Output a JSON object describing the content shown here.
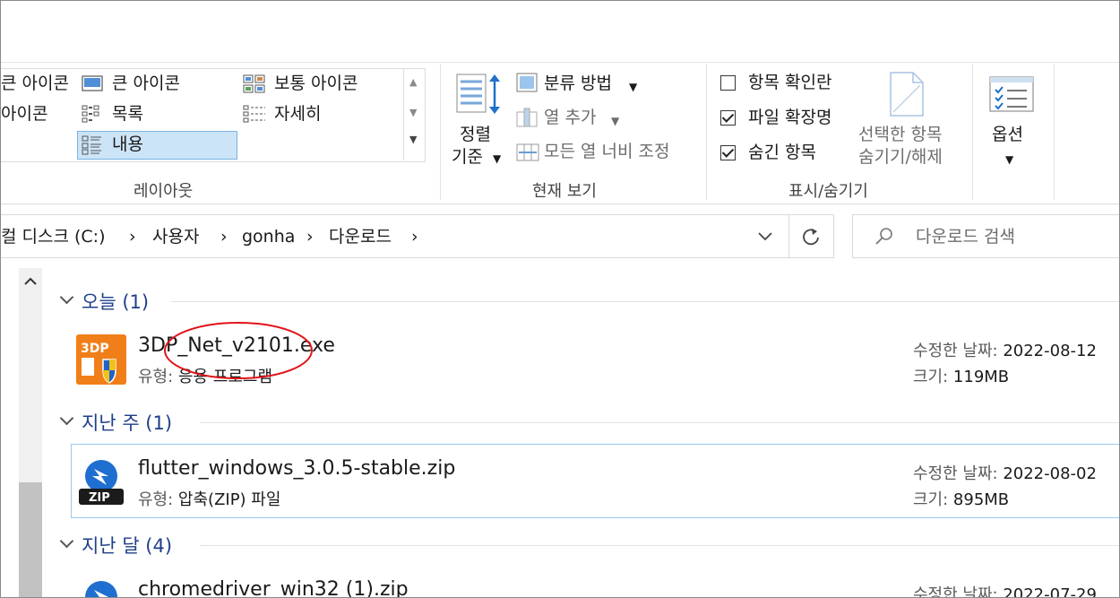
{
  "ribbon": {
    "layout": {
      "items": [
        "큰 아이콘",
        "큰 아이콘",
        "보통 아이콘",
        "아이콘",
        "목록",
        "자세히",
        "내용"
      ],
      "group_label": "레이아웃"
    },
    "current_view": {
      "sort_label_1": "정렬",
      "sort_label_2": "기준",
      "group_by": "분류 방법",
      "add_column": "열 추가",
      "fit_columns": "모든 열 너비 조정",
      "group_label": "현재 보기"
    },
    "show_hide": {
      "item_checkboxes": "항목 확인란",
      "file_extensions": "파일 확장명",
      "hidden_items": "숨긴 항목",
      "hide_selected_1": "선택한 항목",
      "hide_selected_2": "숨기기/해제",
      "group_label": "표시/숨기기"
    },
    "options": {
      "label": "옵션"
    }
  },
  "address": {
    "crumbs": [
      "컬 디스크 (C:)",
      "사용자",
      "gonha",
      "다운로드"
    ],
    "separator": "›"
  },
  "search": {
    "placeholder": "다운로드 검색"
  },
  "groups": [
    {
      "header": "오늘 (1)",
      "files": [
        {
          "name": "3DP_Net_v2101.exe",
          "type_label": "유형:",
          "type": "응용 프로그램",
          "modified_label": "수정한 날짜:",
          "modified": "2022-08-12",
          "size_label": "크기:",
          "size": "119MB",
          "icon": "3dp-app-icon"
        }
      ]
    },
    {
      "header": "지난 주 (1)",
      "files": [
        {
          "name": "flutter_windows_3.0.5-stable.zip",
          "type_label": "유형:",
          "type": "압축(ZIP) 파일",
          "modified_label": "수정한 날짜:",
          "modified": "2022-08-02",
          "size_label": "크기:",
          "size": "895MB",
          "icon": "zip-icon"
        }
      ]
    },
    {
      "header": "지난 달 (4)",
      "files": [
        {
          "name": "chromedriver_win32 (1).zip",
          "modified_label": "수정한 날짜:",
          "modified": "2022-07-29",
          "icon": "zip-icon"
        }
      ]
    }
  ],
  "colors": {
    "accent": "#1e3f8a",
    "selection": "#cce4f7",
    "annotation": "#e0141b"
  }
}
